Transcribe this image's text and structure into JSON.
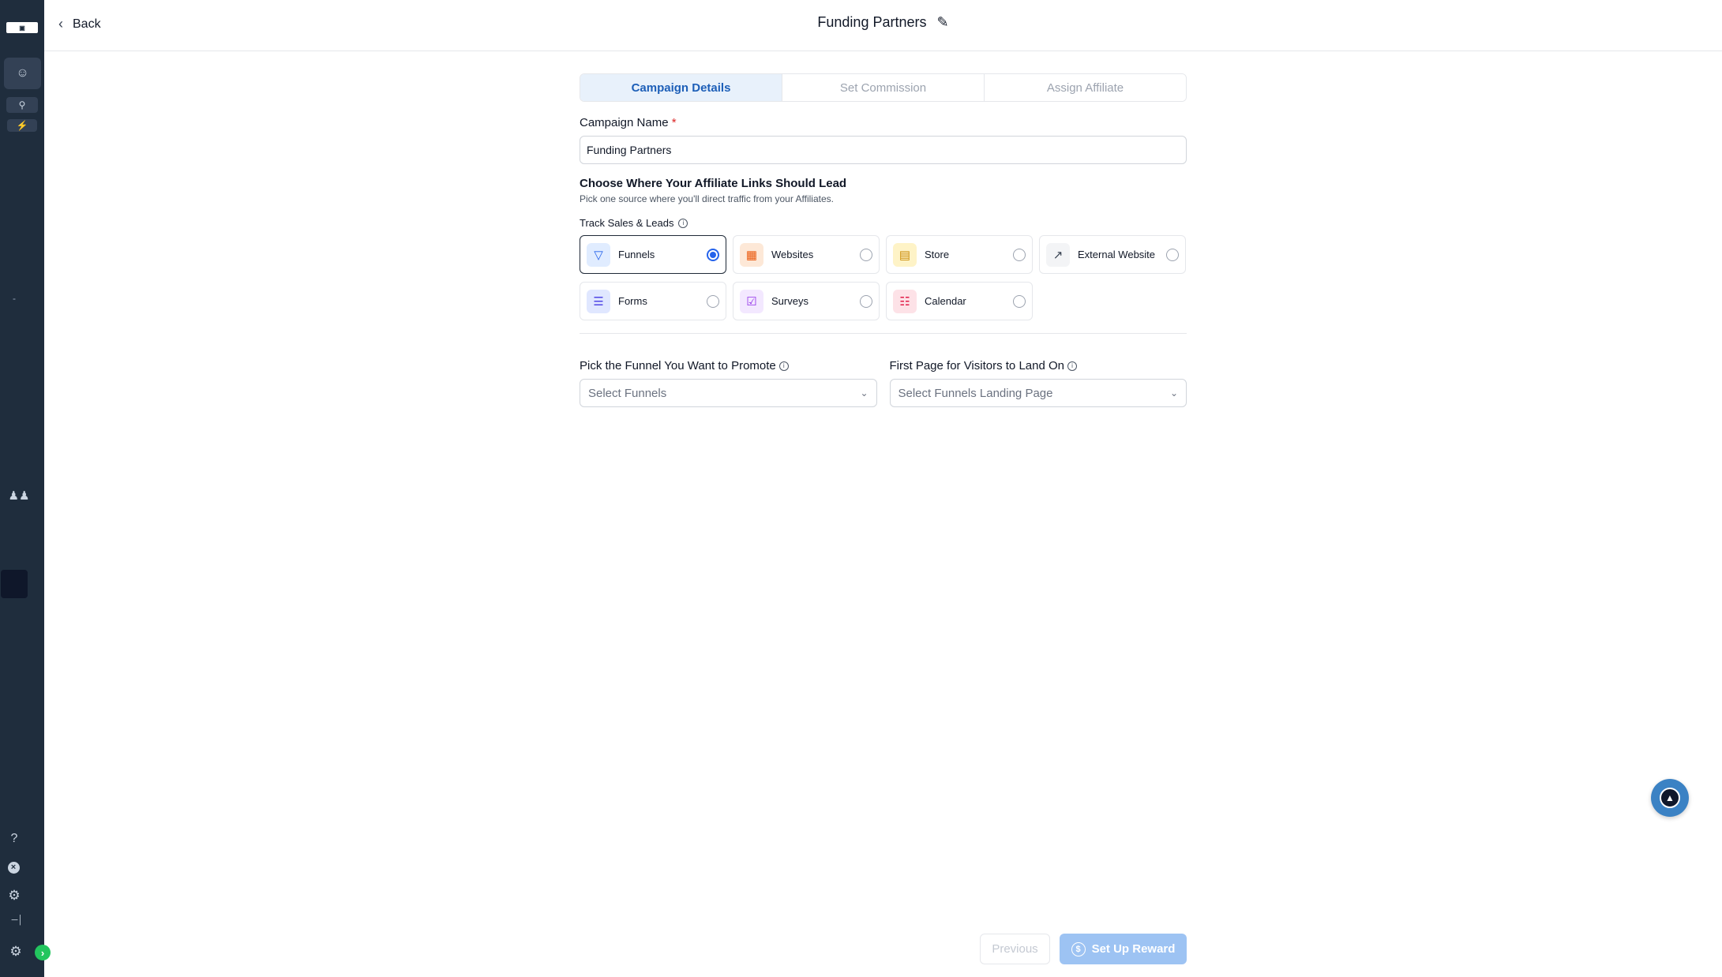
{
  "header": {
    "back_label": "Back",
    "title": "Funding Partners"
  },
  "tabs": [
    {
      "label": "Campaign Details",
      "active": true
    },
    {
      "label": "Set Commission",
      "active": false
    },
    {
      "label": "Assign Affiliate",
      "active": false
    }
  ],
  "form": {
    "campaign_name_label": "Campaign Name",
    "required_mark": "*",
    "campaign_name_value": "Funding Partners",
    "destination_title": "Choose Where Your Affiliate Links Should Lead",
    "destination_subtitle": "Pick one source where you'll direct traffic from your Affiliates.",
    "track_label": "Track Sales & Leads",
    "options": [
      {
        "label": "Funnels",
        "icon": "funnel-icon",
        "selected": true,
        "icon_bg": "#e0ecff",
        "icon_color": "#2563eb"
      },
      {
        "label": "Websites",
        "icon": "website-icon",
        "selected": false,
        "icon_bg": "#fde8d7",
        "icon_color": "#ea580c"
      },
      {
        "label": "Store",
        "icon": "store-icon",
        "selected": false,
        "icon_bg": "#fef3c7",
        "icon_color": "#ca8a04"
      },
      {
        "label": "External Website",
        "icon": "external-link-icon",
        "selected": false,
        "icon_bg": "#f3f4f6",
        "icon_color": "#374151"
      },
      {
        "label": "Forms",
        "icon": "form-icon",
        "selected": false,
        "icon_bg": "#e0e7ff",
        "icon_color": "#4f46e5"
      },
      {
        "label": "Surveys",
        "icon": "survey-icon",
        "selected": false,
        "icon_bg": "#f3e8ff",
        "icon_color": "#9333ea"
      },
      {
        "label": "Calendar",
        "icon": "calendar-icon",
        "selected": false,
        "icon_bg": "#fde2e7",
        "icon_color": "#e11d48"
      }
    ],
    "funnel_label": "Pick the Funnel You Want to Promote",
    "funnel_placeholder": "Select Funnels",
    "landing_label": "First Page for Visitors to Land On",
    "landing_placeholder": "Select Funnels Landing Page"
  },
  "footer": {
    "previous_label": "Previous",
    "next_label": "Set Up Reward"
  },
  "colors": {
    "sidebar_bg": "#1f2d3d",
    "accent": "#2563eb",
    "active_tab_bg": "#e8f1fb",
    "primary_button_disabled": "#9dc3f3"
  }
}
